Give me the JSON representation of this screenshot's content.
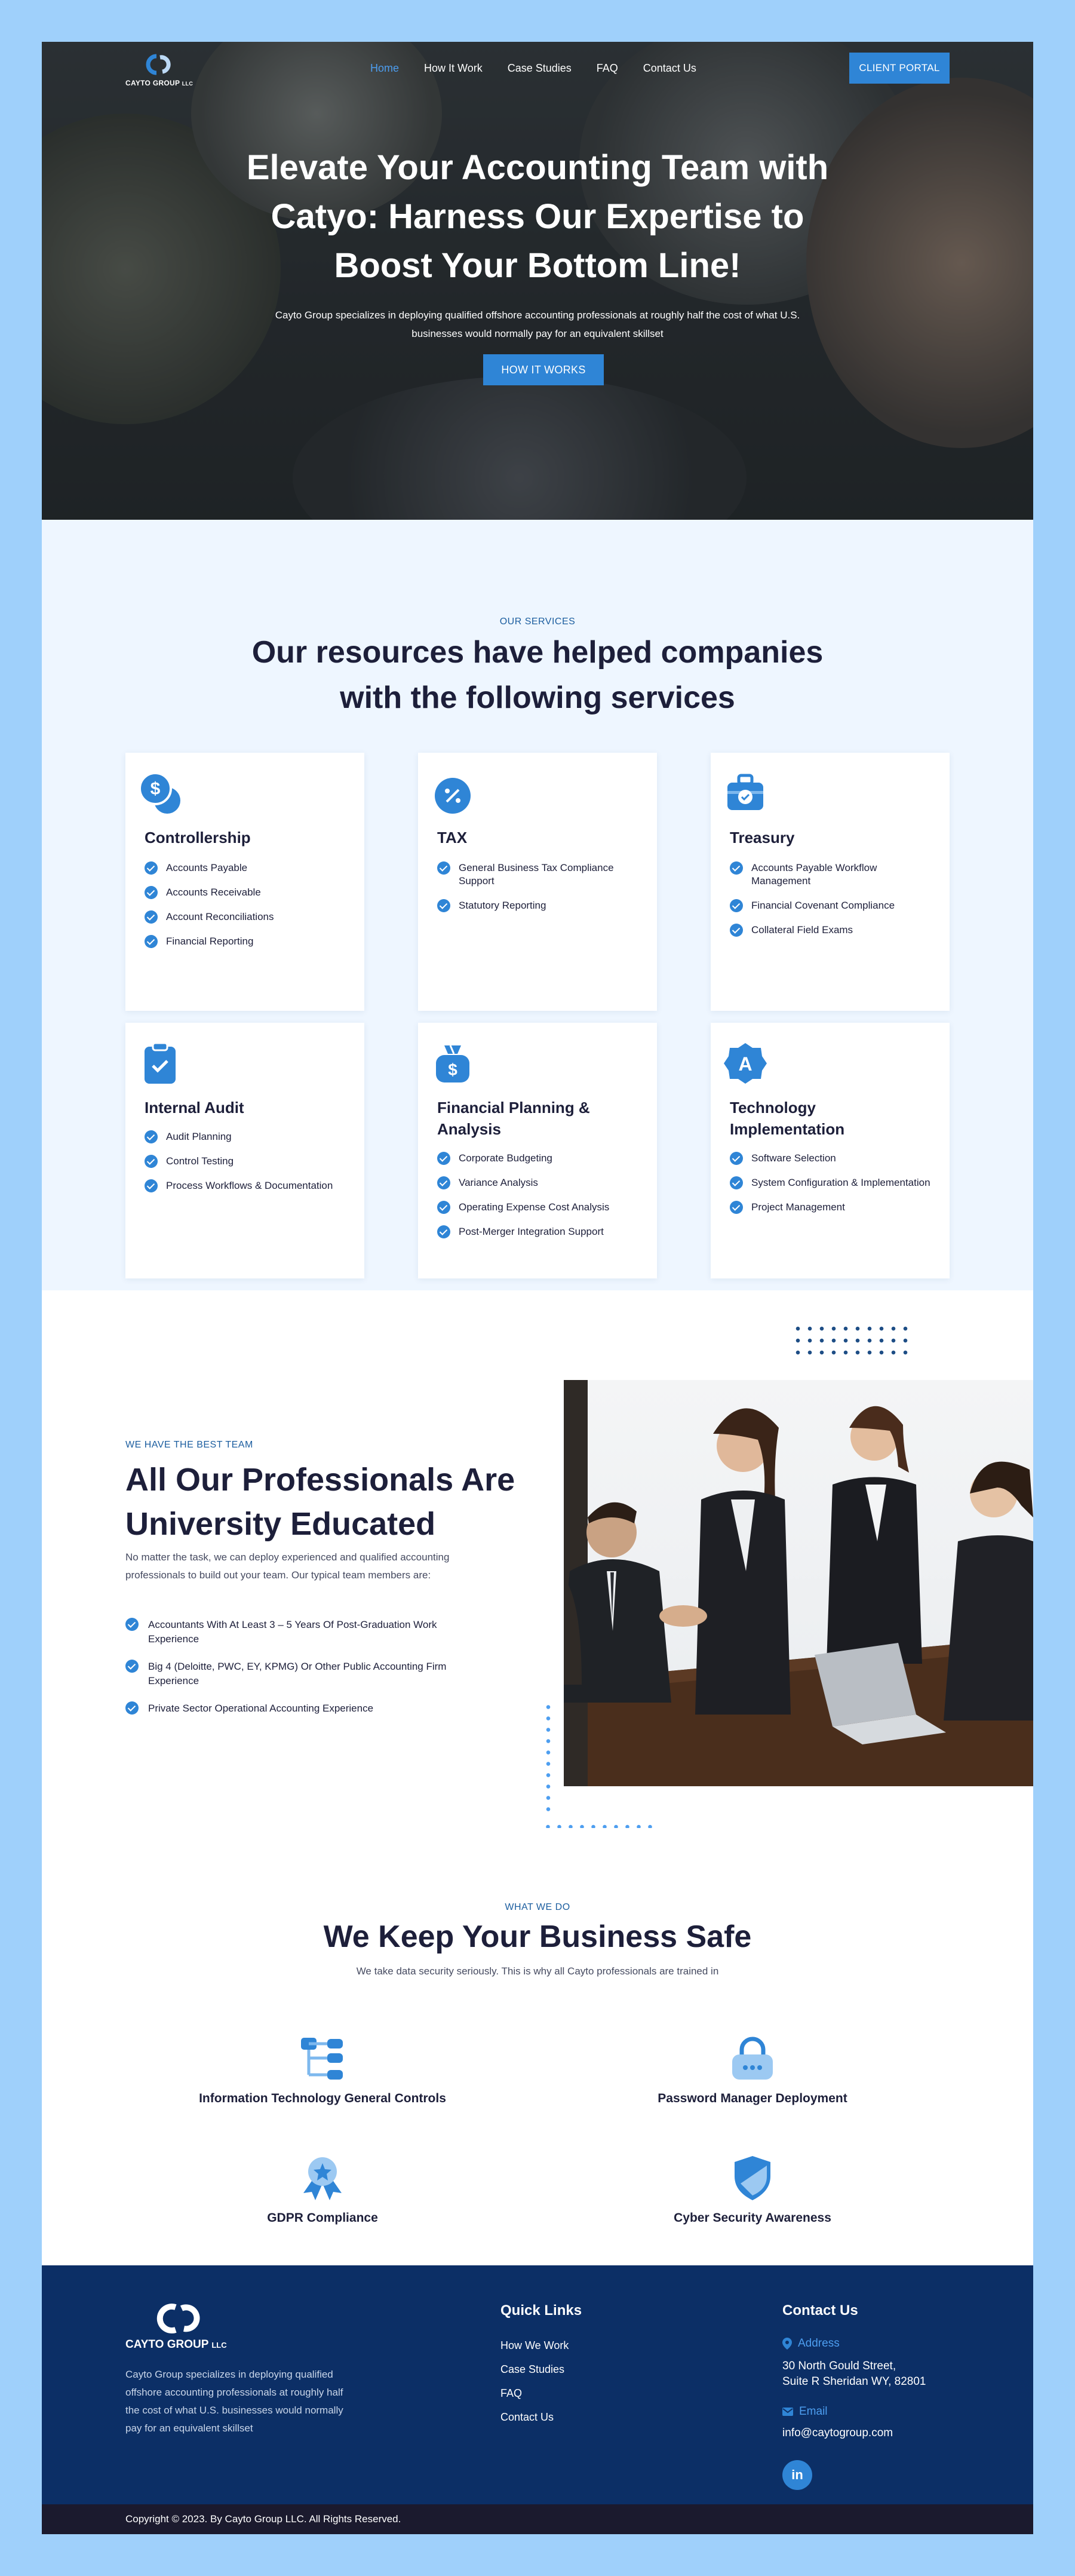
{
  "header": {
    "logo_text": "CAYTO GROUP",
    "logo_suffix": "LLC",
    "nav": [
      "Home",
      "How It Work",
      "Case Studies",
      "FAQ",
      "Contact Us"
    ],
    "portal_button": "CLIENT PORTAL"
  },
  "hero": {
    "title": "Elevate Your Accounting Team with Catyo: Harness Our Expertise to Boost Your Bottom Line!",
    "subtitle": "Cayto Group specializes in deploying qualified offshore accounting professionals at roughly half the cost of what U.S. businesses would normally pay for an equivalent skillset",
    "button": "HOW IT WORKS"
  },
  "services": {
    "eyebrow": "OUR SERVICES",
    "title": "Our resources have helped companies with the following services",
    "cards": [
      {
        "title": "Controllership",
        "icon": "dollar-coin-icon",
        "items": [
          "Accounts Payable",
          "Accounts Receivable",
          "Account Reconciliations",
          "Financial Reporting"
        ]
      },
      {
        "title": "TAX",
        "icon": "percent-icon",
        "items": [
          "General Business Tax Compliance Support",
          "Statutory Reporting"
        ]
      },
      {
        "title": "Treasury",
        "icon": "briefcase-icon",
        "items": [
          "Accounts Payable Workflow Management",
          "Financial Covenant Compliance",
          "Collateral Field Exams"
        ]
      },
      {
        "title": "Internal Audit",
        "icon": "clipboard-check-icon",
        "items": [
          "Audit Planning",
          "Control Testing",
          "Process Workflows & Documentation"
        ]
      },
      {
        "title": "Financial Planning & Analysis",
        "icon": "money-bag-icon",
        "items": [
          "Corporate Budgeting",
          "Variance Analysis",
          "Operating Expense Cost Analysis",
          "Post-Merger Integration Support"
        ]
      },
      {
        "title": "Technology Implementation",
        "icon": "badge-a-icon",
        "items": [
          "Software Selection",
          "System Configuration & Implementation",
          "Project Management"
        ]
      }
    ]
  },
  "team": {
    "eyebrow": "WE HAVE THE BEST TEAM",
    "title": "All Our Professionals Are University Educated",
    "description": "No matter the task, we can deploy experienced and qualified accounting professionals to build out your team. Our typical team members are:",
    "items": [
      "Accountants With At Least 3 – 5 Years Of Post-Graduation Work Experience",
      "Big 4 (Deloitte, PWC, EY, KPMG) Or Other Public Accounting Firm Experience",
      "Private Sector Operational Accounting Experience"
    ]
  },
  "safe": {
    "eyebrow": "WHAT WE DO",
    "title": "We Keep Your Business Safe",
    "subtitle": "We take data security seriously. This is why all Cayto professionals are trained in",
    "items": [
      {
        "label": "Information Technology General Controls",
        "icon": "hierarchy-icon"
      },
      {
        "label": "Password Manager Deployment",
        "icon": "lock-icon"
      },
      {
        "label": "GDPR Compliance",
        "icon": "award-ribbon-icon"
      },
      {
        "label": "Cyber Security Awareness",
        "icon": "shield-icon"
      }
    ]
  },
  "footer": {
    "logo_text": "CAYTO GROUP",
    "logo_suffix": "LLC",
    "about": "Cayto Group specializes in deploying qualified offshore accounting professionals at roughly half the cost of what U.S. businesses would normally pay for an equivalent skillset",
    "quick_links_title": "Quick Links",
    "quick_links": [
      "How We Work",
      "Case Studies",
      "FAQ",
      "Contact Us"
    ],
    "contact_title": "Contact Us",
    "address_label": "Address",
    "address_line1": "30 North Gould Street,",
    "address_line2": "Suite R Sheridan WY, 82801",
    "email_label": "Email",
    "email": "info@caytogroup.com",
    "social_icon": "linkedin-icon",
    "copyright": "Copyright © 2023. By Cayto Group LLC. All Rights Reserved."
  },
  "colors": {
    "accent": "#2f85d6",
    "navy": "#0c2f66",
    "page_bg": "#9fd0fb",
    "section_bg": "#eef6ff"
  }
}
